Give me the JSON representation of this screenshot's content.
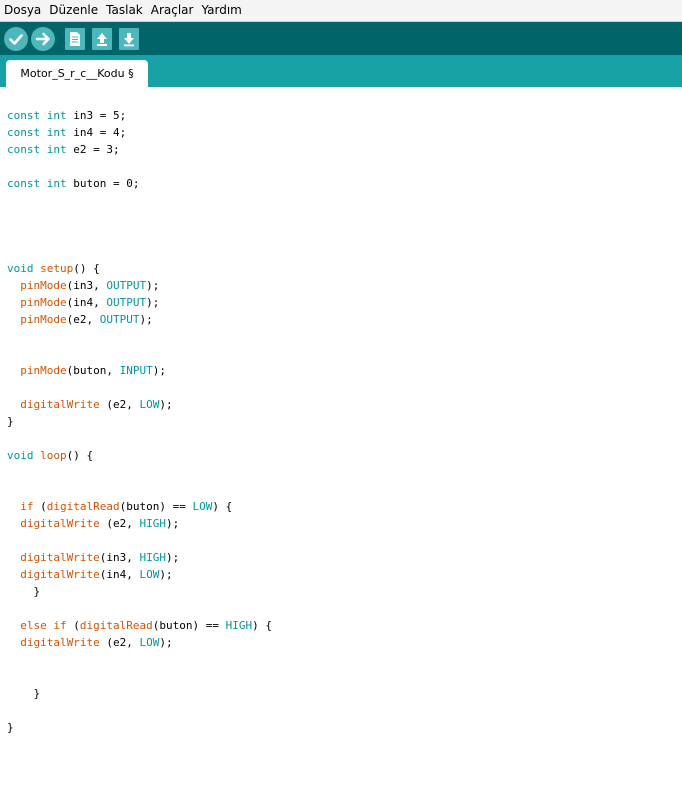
{
  "menu": [
    "Dosya",
    "Düzenle",
    "Taslak",
    "Araçlar",
    "Yardım"
  ],
  "toolbar": [
    {
      "name": "verify-button",
      "icon": "checkmark-icon"
    },
    {
      "name": "upload-button",
      "icon": "arrow-right-icon"
    },
    {
      "name": "new-button",
      "icon": "new-file-icon"
    },
    {
      "name": "open-button",
      "icon": "arrow-up-icon"
    },
    {
      "name": "save-button",
      "icon": "arrow-down-icon"
    }
  ],
  "tab": {
    "label": "Motor_S_r_c__Kodu §"
  },
  "colors": {
    "menubar": "#f4f4f4",
    "toolbar": "#006468",
    "tabbar": "#17a1a5",
    "button": "#4db7bb",
    "keyword": "#00979c",
    "function": "#d35400"
  },
  "code": [
    {
      "line": 1,
      "tokens": [
        {
          "t": "const",
          "c": "kw"
        },
        {
          "t": " "
        },
        {
          "t": "int",
          "c": "kw"
        },
        {
          "t": " in3 = 5;"
        }
      ]
    },
    {
      "line": 2,
      "tokens": [
        {
          "t": "const",
          "c": "kw"
        },
        {
          "t": " "
        },
        {
          "t": "int",
          "c": "kw"
        },
        {
          "t": " in4 = 4;"
        }
      ]
    },
    {
      "line": 3,
      "tokens": [
        {
          "t": "const",
          "c": "kw"
        },
        {
          "t": " "
        },
        {
          "t": "int",
          "c": "kw"
        },
        {
          "t": " e2 = 3;"
        }
      ]
    },
    {
      "line": 5,
      "tokens": [
        {
          "t": "const",
          "c": "kw"
        },
        {
          "t": " "
        },
        {
          "t": "int",
          "c": "kw"
        },
        {
          "t": " buton = 0;"
        }
      ]
    },
    {
      "line": 10,
      "tokens": [
        {
          "t": "void",
          "c": "kw"
        },
        {
          "t": " "
        },
        {
          "t": "setup",
          "c": "fn"
        },
        {
          "t": "() {"
        }
      ]
    },
    {
      "line": 11,
      "tokens": [
        {
          "t": "  "
        },
        {
          "t": "pinMode",
          "c": "fn"
        },
        {
          "t": "(in3, "
        },
        {
          "t": "OUTPUT",
          "c": "const"
        },
        {
          "t": ");"
        }
      ]
    },
    {
      "line": 12,
      "tokens": [
        {
          "t": "  "
        },
        {
          "t": "pinMode",
          "c": "fn"
        },
        {
          "t": "(in4, "
        },
        {
          "t": "OUTPUT",
          "c": "const"
        },
        {
          "t": ");"
        }
      ]
    },
    {
      "line": 13,
      "tokens": [
        {
          "t": "  "
        },
        {
          "t": "pinMode",
          "c": "fn"
        },
        {
          "t": "(e2, "
        },
        {
          "t": "OUTPUT",
          "c": "const"
        },
        {
          "t": ");"
        }
      ]
    },
    {
      "line": 16,
      "tokens": [
        {
          "t": "  "
        },
        {
          "t": "pinMode",
          "c": "fn"
        },
        {
          "t": "(buton, "
        },
        {
          "t": "INPUT",
          "c": "const"
        },
        {
          "t": ");"
        }
      ]
    },
    {
      "line": 18,
      "tokens": [
        {
          "t": "  "
        },
        {
          "t": "digitalWrite",
          "c": "fn"
        },
        {
          "t": " (e2, "
        },
        {
          "t": "LOW",
          "c": "const"
        },
        {
          "t": ");"
        }
      ]
    },
    {
      "line": 19,
      "tokens": [
        {
          "t": "}"
        }
      ]
    },
    {
      "line": 21,
      "tokens": [
        {
          "t": "void",
          "c": "kw"
        },
        {
          "t": " "
        },
        {
          "t": "loop",
          "c": "fn"
        },
        {
          "t": "() {"
        }
      ]
    },
    {
      "line": 24,
      "tokens": [
        {
          "t": "  "
        },
        {
          "t": "if",
          "c": "fn"
        },
        {
          "t": " ("
        },
        {
          "t": "digitalRead",
          "c": "fn"
        },
        {
          "t": "(buton) == "
        },
        {
          "t": "LOW",
          "c": "const"
        },
        {
          "t": ") {"
        }
      ]
    },
    {
      "line": 25,
      "tokens": [
        {
          "t": "  "
        },
        {
          "t": "digitalWrite",
          "c": "fn"
        },
        {
          "t": " (e2, "
        },
        {
          "t": "HIGH",
          "c": "const"
        },
        {
          "t": ");"
        }
      ]
    },
    {
      "line": 27,
      "tokens": [
        {
          "t": "  "
        },
        {
          "t": "digitalWrite",
          "c": "fn"
        },
        {
          "t": "(in3, "
        },
        {
          "t": "HIGH",
          "c": "const"
        },
        {
          "t": ");"
        }
      ]
    },
    {
      "line": 28,
      "tokens": [
        {
          "t": "  "
        },
        {
          "t": "digitalWrite",
          "c": "fn"
        },
        {
          "t": "(in4, "
        },
        {
          "t": "LOW",
          "c": "const"
        },
        {
          "t": ");"
        }
      ]
    },
    {
      "line": 29,
      "tokens": [
        {
          "t": "    }"
        }
      ]
    },
    {
      "line": 31,
      "tokens": [
        {
          "t": "  "
        },
        {
          "t": "else",
          "c": "fn"
        },
        {
          "t": " "
        },
        {
          "t": "if",
          "c": "fn"
        },
        {
          "t": " ("
        },
        {
          "t": "digitalRead",
          "c": "fn"
        },
        {
          "t": "(buton) == "
        },
        {
          "t": "HIGH",
          "c": "const"
        },
        {
          "t": ") {"
        }
      ]
    },
    {
      "line": 32,
      "tokens": [
        {
          "t": "  "
        },
        {
          "t": "digitalWrite",
          "c": "fn"
        },
        {
          "t": " (e2, "
        },
        {
          "t": "LOW",
          "c": "const"
        },
        {
          "t": ");"
        }
      ]
    },
    {
      "line": 35,
      "tokens": [
        {
          "t": "    }"
        }
      ]
    },
    {
      "line": 37,
      "tokens": [
        {
          "t": "}"
        }
      ]
    }
  ]
}
